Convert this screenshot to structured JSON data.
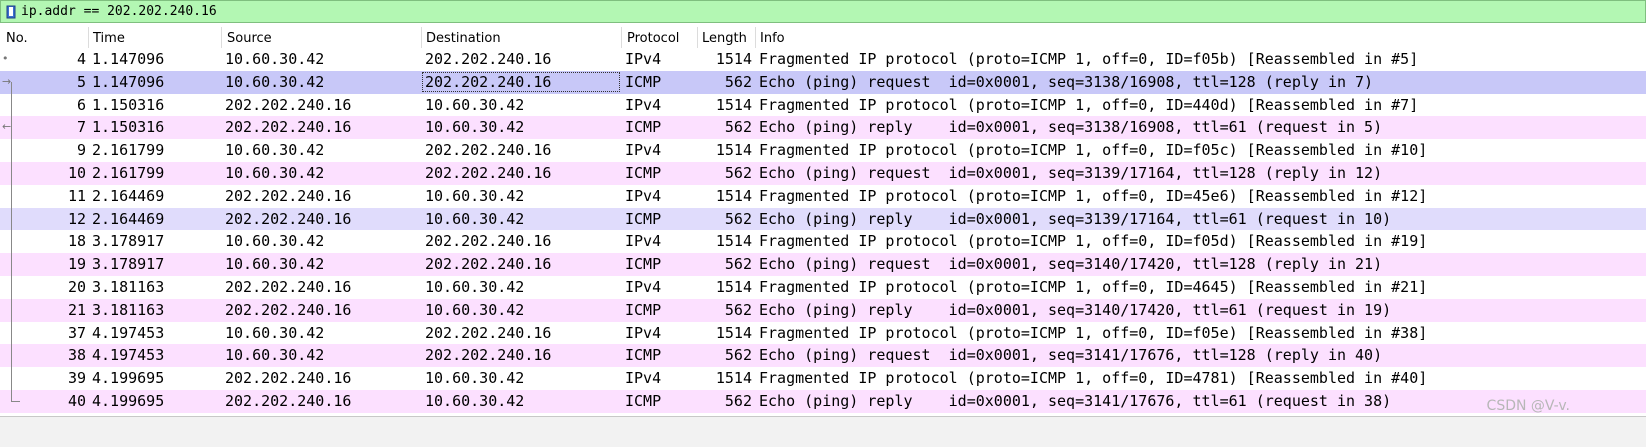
{
  "filter": {
    "value": "ip.addr == 202.202.240.16"
  },
  "columns": {
    "no": "No.",
    "time": "Time",
    "source": "Source",
    "destination": "Destination",
    "protocol": "Protocol",
    "length": "Length",
    "info": "Info"
  },
  "rows": [
    {
      "no": "4",
      "time": "1.147096",
      "source": "10.60.30.42",
      "destination": "202.202.240.16",
      "protocol": "IPv4",
      "length": "1514",
      "info": "Fragmented IP protocol (proto=ICMP 1, off=0, ID=f05b) [Reassembled in #5]",
      "bg": "#ffffff",
      "mark": "•"
    },
    {
      "no": "5",
      "time": "1.147096",
      "source": "10.60.30.42",
      "destination": "202.202.240.16",
      "protocol": "ICMP",
      "length": "562",
      "info": "Echo (ping) request  id=0x0001, seq=3138/16908, ttl=128 (reply in 7)",
      "bg": "#c8c8f8",
      "mark": "→"
    },
    {
      "no": "6",
      "time": "1.150316",
      "source": "202.202.240.16",
      "destination": "10.60.30.42",
      "protocol": "IPv4",
      "length": "1514",
      "info": "Fragmented IP protocol (proto=ICMP 1, off=0, ID=440d) [Reassembled in #7]",
      "bg": "#ffffff",
      "mark": ""
    },
    {
      "no": "7",
      "time": "1.150316",
      "source": "202.202.240.16",
      "destination": "10.60.30.42",
      "protocol": "ICMP",
      "length": "562",
      "info": "Echo (ping) reply    id=0x0001, seq=3138/16908, ttl=61 (request in 5)",
      "bg": "#fce0ff",
      "mark": "←"
    },
    {
      "no": "9",
      "time": "2.161799",
      "source": "10.60.30.42",
      "destination": "202.202.240.16",
      "protocol": "IPv4",
      "length": "1514",
      "info": "Fragmented IP protocol (proto=ICMP 1, off=0, ID=f05c) [Reassembled in #10]",
      "bg": "#ffffff",
      "mark": ""
    },
    {
      "no": "10",
      "time": "2.161799",
      "source": "10.60.30.42",
      "destination": "202.202.240.16",
      "protocol": "ICMP",
      "length": "562",
      "info": "Echo (ping) request  id=0x0001, seq=3139/17164, ttl=128 (reply in 12)",
      "bg": "#fce0ff",
      "mark": ""
    },
    {
      "no": "11",
      "time": "2.164469",
      "source": "202.202.240.16",
      "destination": "10.60.30.42",
      "protocol": "IPv4",
      "length": "1514",
      "info": "Fragmented IP protocol (proto=ICMP 1, off=0, ID=45e6) [Reassembled in #12]",
      "bg": "#ffffff",
      "mark": ""
    },
    {
      "no": "12",
      "time": "2.164469",
      "source": "202.202.240.16",
      "destination": "10.60.30.42",
      "protocol": "ICMP",
      "length": "562",
      "info": "Echo (ping) reply    id=0x0001, seq=3139/17164, ttl=61 (request in 10)",
      "bg": "#e0dcfc",
      "mark": ""
    },
    {
      "no": "18",
      "time": "3.178917",
      "source": "10.60.30.42",
      "destination": "202.202.240.16",
      "protocol": "IPv4",
      "length": "1514",
      "info": "Fragmented IP protocol (proto=ICMP 1, off=0, ID=f05d) [Reassembled in #19]",
      "bg": "#ffffff",
      "mark": ""
    },
    {
      "no": "19",
      "time": "3.178917",
      "source": "10.60.30.42",
      "destination": "202.202.240.16",
      "protocol": "ICMP",
      "length": "562",
      "info": "Echo (ping) request  id=0x0001, seq=3140/17420, ttl=128 (reply in 21)",
      "bg": "#fce0ff",
      "mark": ""
    },
    {
      "no": "20",
      "time": "3.181163",
      "source": "202.202.240.16",
      "destination": "10.60.30.42",
      "protocol": "IPv4",
      "length": "1514",
      "info": "Fragmented IP protocol (proto=ICMP 1, off=0, ID=4645) [Reassembled in #21]",
      "bg": "#ffffff",
      "mark": ""
    },
    {
      "no": "21",
      "time": "3.181163",
      "source": "202.202.240.16",
      "destination": "10.60.30.42",
      "protocol": "ICMP",
      "length": "562",
      "info": "Echo (ping) reply    id=0x0001, seq=3140/17420, ttl=61 (request in 19)",
      "bg": "#fce0ff",
      "mark": ""
    },
    {
      "no": "37",
      "time": "4.197453",
      "source": "10.60.30.42",
      "destination": "202.202.240.16",
      "protocol": "IPv4",
      "length": "1514",
      "info": "Fragmented IP protocol (proto=ICMP 1, off=0, ID=f05e) [Reassembled in #38]",
      "bg": "#ffffff",
      "mark": ""
    },
    {
      "no": "38",
      "time": "4.197453",
      "source": "10.60.30.42",
      "destination": "202.202.240.16",
      "protocol": "ICMP",
      "length": "562",
      "info": "Echo (ping) request  id=0x0001, seq=3141/17676, ttl=128 (reply in 40)",
      "bg": "#fce0ff",
      "mark": ""
    },
    {
      "no": "39",
      "time": "4.199695",
      "source": "202.202.240.16",
      "destination": "10.60.30.42",
      "protocol": "IPv4",
      "length": "1514",
      "info": "Fragmented IP protocol (proto=ICMP 1, off=0, ID=4781) [Reassembled in #40]",
      "bg": "#ffffff",
      "mark": ""
    },
    {
      "no": "40",
      "time": "4.199695",
      "source": "202.202.240.16",
      "destination": "10.60.30.42",
      "protocol": "ICMP",
      "length": "562",
      "info": "Echo (ping) reply    id=0x0001, seq=3141/17676, ttl=61 (request in 38)",
      "bg": "#fce0ff",
      "mark": ""
    }
  ],
  "selected_row_index": 1,
  "watermark": "CSDN @V-v."
}
